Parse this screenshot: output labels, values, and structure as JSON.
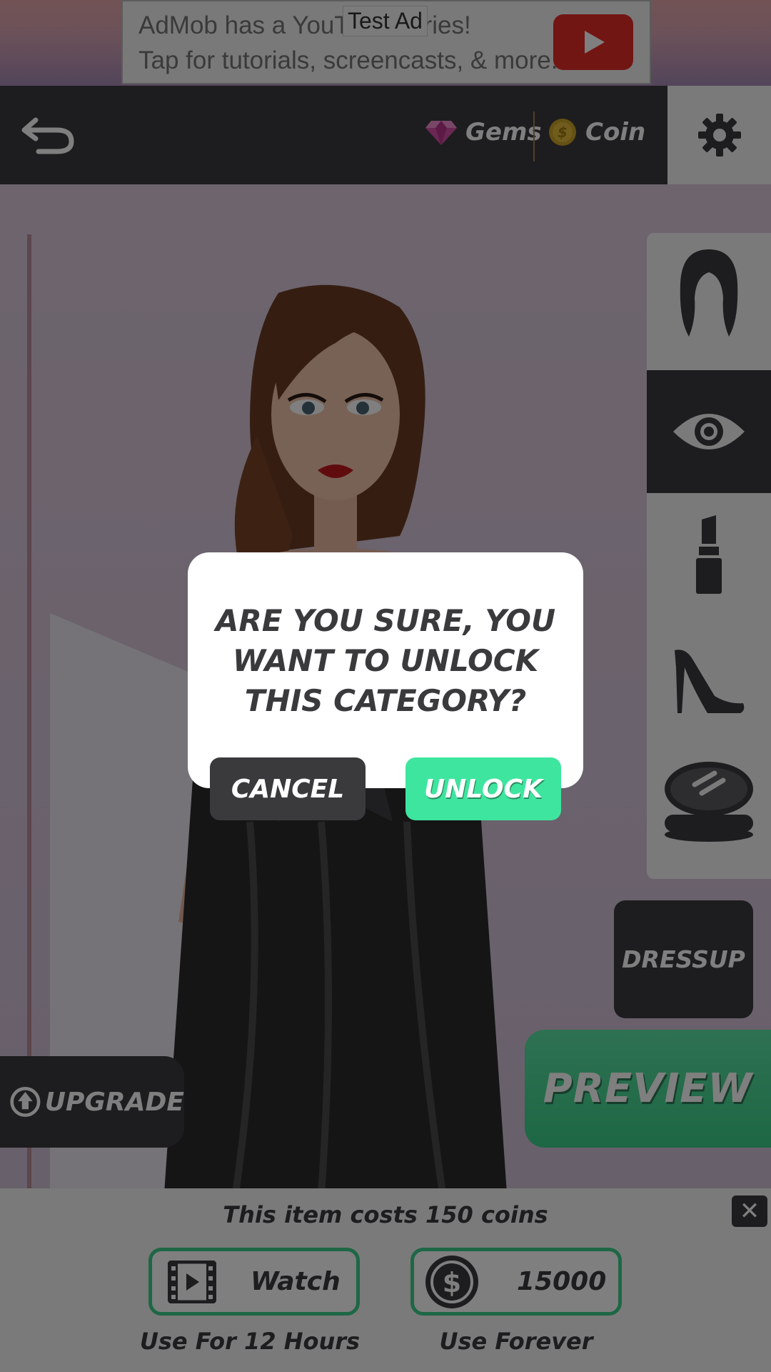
{
  "ad": {
    "line1": "AdMob has a YouTube series!",
    "line2": "Tap for tutorials, screencasts, & more.",
    "test_label": "Test Ad",
    "play_icon": "play-icon"
  },
  "header": {
    "back_icon": "back-arrow-icon",
    "gems_label": "Gems",
    "coin_label": "Coin",
    "settings_icon": "gear-icon"
  },
  "categories": [
    {
      "icon": "hair-icon",
      "active": false
    },
    {
      "icon": "eye-icon",
      "active": true
    },
    {
      "icon": "lipstick-icon",
      "active": false
    },
    {
      "icon": "high-heel-icon",
      "active": false
    },
    {
      "icon": "compact-powder-icon",
      "active": false
    }
  ],
  "buttons": {
    "dressup": "DRESSUP",
    "preview": "PREVIEW",
    "upgrade": "UPGRADE"
  },
  "cost_panel": {
    "text": "This item costs 150 coins",
    "watch_label": "Watch",
    "watch_sub": "Use For 12 Hours",
    "buy_amount": "15000",
    "buy_sub": "Use Forever",
    "close": "✕"
  },
  "dialog": {
    "line1": "ARE YOU SURE, YOU",
    "line2": "WANT TO UNLOCK",
    "line3": "THIS CATEGORY?",
    "cancel": "CANCEL",
    "unlock": "UNLOCK"
  },
  "colors": {
    "dark": "#3a393c",
    "accent_green": "#3ee59f",
    "light": "#f4f4f4"
  }
}
